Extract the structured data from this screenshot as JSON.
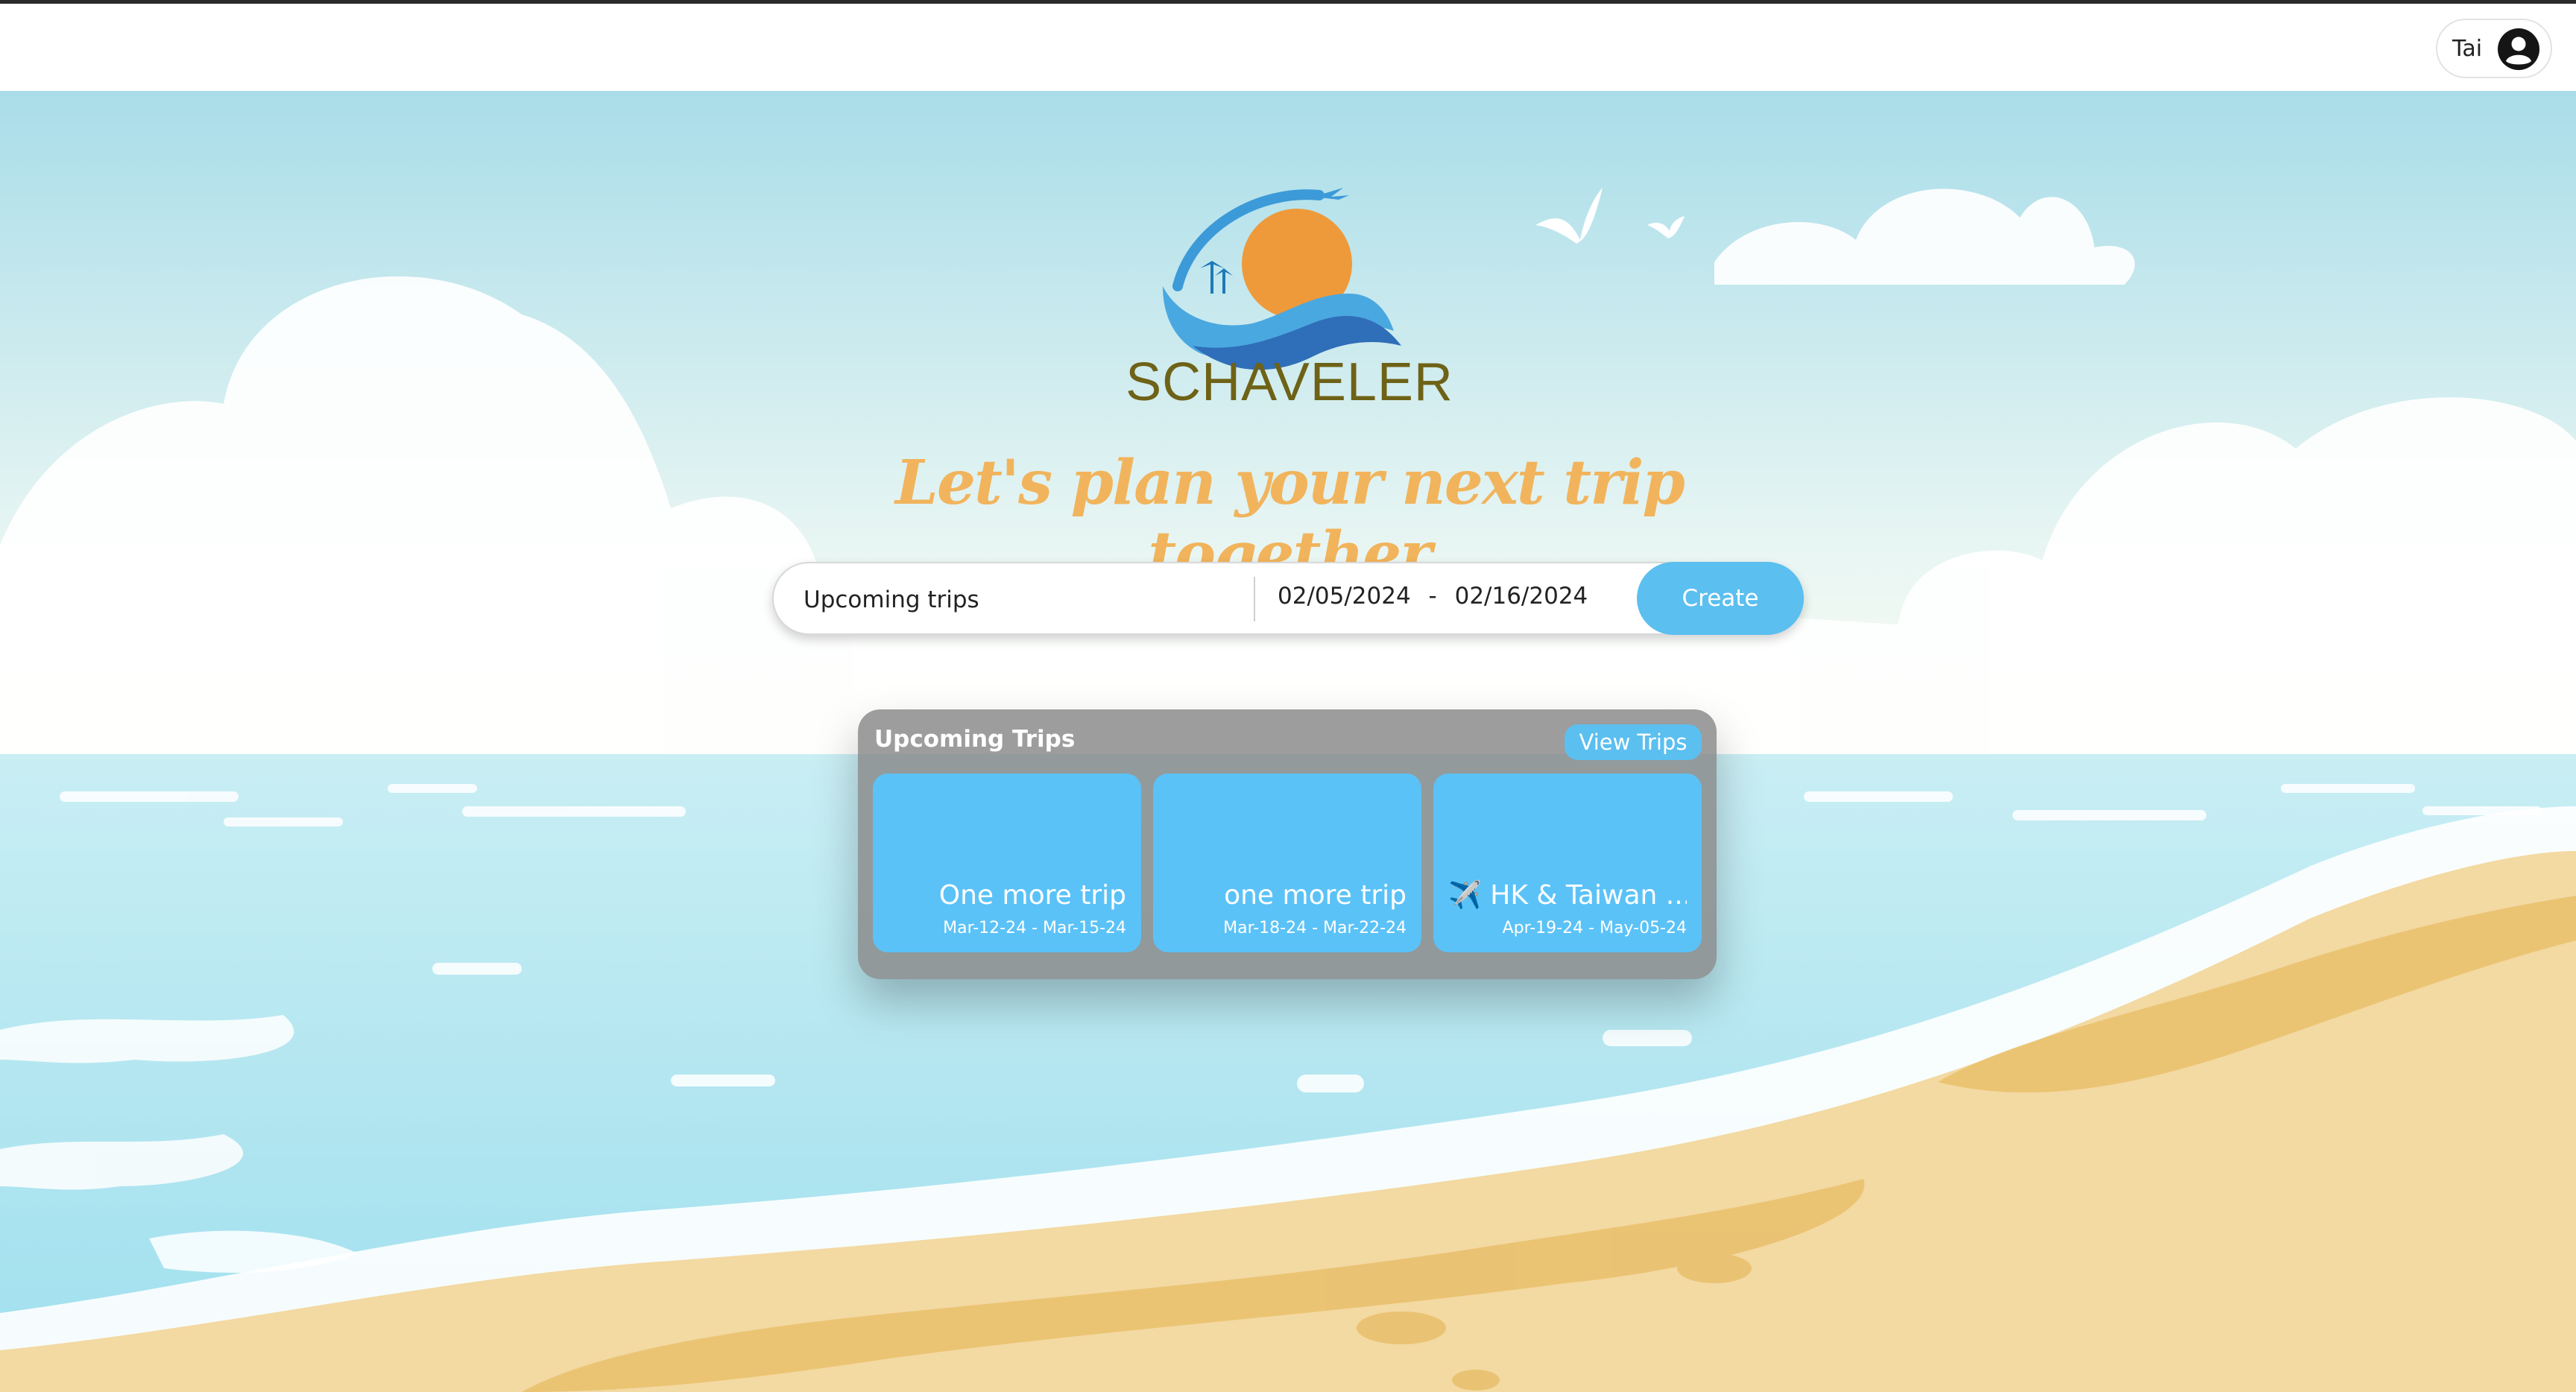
{
  "header": {
    "user_name": "Tai",
    "avatar_icon": "user-circle-icon"
  },
  "hero": {
    "brand_name": "SCHAVELER",
    "tagline": "Let's plan your next trip together"
  },
  "search": {
    "trip_name_value": "Upcoming trips",
    "start_date": "02/05/2024",
    "date_separator": "-",
    "end_date": "02/16/2024",
    "create_label": "Create"
  },
  "upcoming": {
    "title": "Upcoming Trips",
    "view_label": "View Trips",
    "trips": [
      {
        "name": "One more trip",
        "dates": "Mar-12-24 - Mar-15-24"
      },
      {
        "name": "one more trip",
        "dates": "Mar-18-24 - Mar-22-24"
      },
      {
        "name": "✈️ HK & Taiwan ...",
        "dates": "Apr-19-24 - May-05-24"
      }
    ]
  },
  "colors": {
    "accent": "#5bbfef",
    "brand_text": "#6e6217",
    "tagline": "#f1b45c",
    "sky": "#bfe6ef",
    "sea": "#a6e0ee",
    "sand": "#f3d9a2"
  }
}
